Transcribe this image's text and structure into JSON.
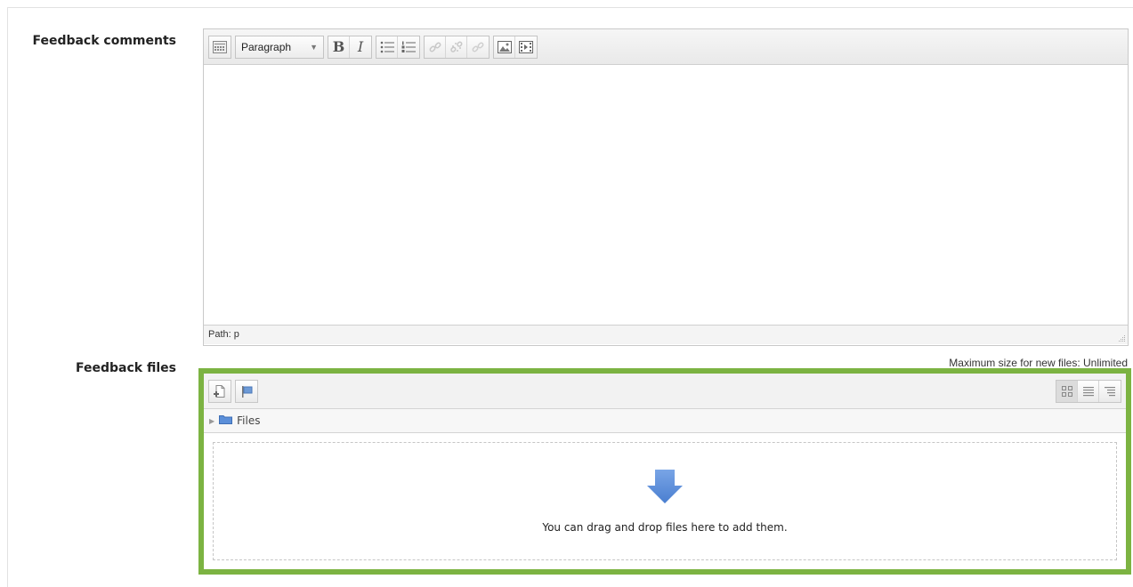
{
  "feedback_comments": {
    "label": "Feedback comments",
    "toolbar": {
      "format_select": "Paragraph",
      "bold_label": "B",
      "italic_label": "I",
      "icons": [
        "toolbar-toggle-icon",
        "bullet-list-icon",
        "numbered-list-icon",
        "link-icon",
        "unlink-icon",
        "anchor-icon",
        "image-icon",
        "media-icon"
      ]
    },
    "content": "",
    "status_path": "Path: p"
  },
  "feedback_files": {
    "label": "Feedback files",
    "max_size_text": "Maximum size for new files: Unlimited",
    "path_folder": "Files",
    "drop_text": "You can drag and drop files here to add them.",
    "accent_color": "#7cb342",
    "arrow_color": "#5b8fd9"
  }
}
